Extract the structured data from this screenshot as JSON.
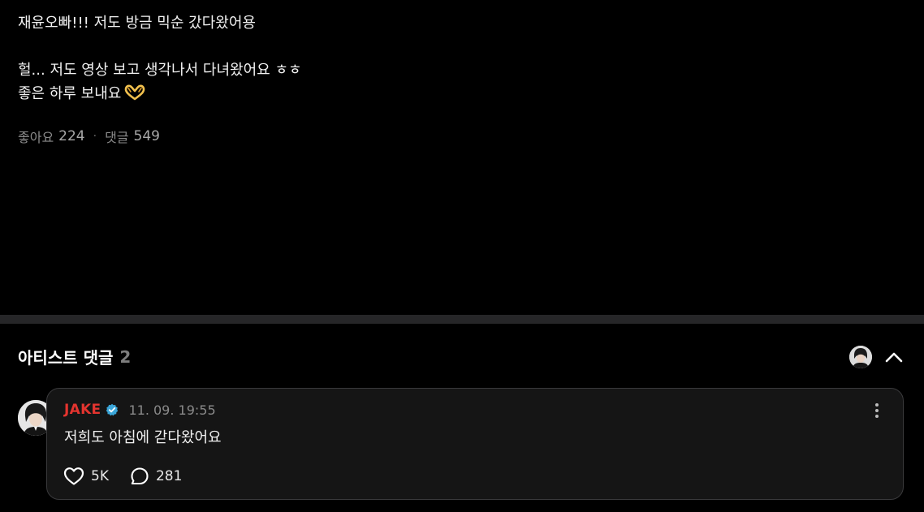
{
  "post": {
    "lines": [
      "재윤오빠!!! 저도 방금 믹순 갔다왔어용",
      "헐... 저도 영상 보고 생각나서 다녀왔어요 ㅎㅎ",
      "좋은 하루 보내요"
    ],
    "emoji": "heart-hands-emoji",
    "likes_label": "좋아요",
    "likes_count": "224",
    "comments_label": "댓글",
    "comments_count": "549",
    "separator": "·"
  },
  "artist_comments": {
    "title": "아티스트 댓글",
    "count": "2",
    "header_avatar": "artist-avatar",
    "collapse_icon": "chevron-up-icon"
  },
  "comment": {
    "author": "JAKE",
    "verified_icon": "verified-badge-icon",
    "timestamp": "11. 09. 19:55",
    "text": "저희도 아침에 갇다왔어요",
    "likes": "5K",
    "replies": "281",
    "more_icon": "more-vertical-icon"
  },
  "colors": {
    "background": "#000000",
    "card": "#151515",
    "card_border": "#3a3a3c",
    "author": "#e3342f",
    "verified": "#3aa6d9",
    "muted": "#8a8a8a",
    "divider": "#262628"
  }
}
